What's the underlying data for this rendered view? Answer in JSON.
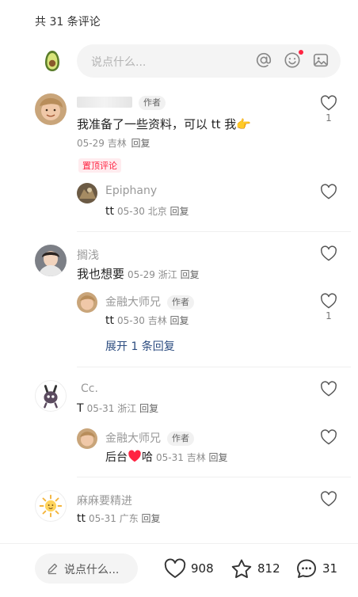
{
  "header": {
    "count_text": "共 31 条评论"
  },
  "composer": {
    "placeholder": "说点什么...",
    "icons": [
      "at-icon",
      "emoji-icon",
      "image-icon"
    ]
  },
  "comments": [
    {
      "nick": "",
      "author_tag": "作者",
      "text": "我准备了一些资料，可以 tt 我👉",
      "date": "05-29",
      "location": "吉林",
      "reply": "回复",
      "pinned": "置顶评论",
      "likes": "1",
      "replies": [
        {
          "nick": "Epiphany",
          "text": "tt",
          "date": "05-30",
          "location": "北京",
          "reply": "回复"
        }
      ]
    },
    {
      "nick": "搁浅",
      "text": "我也想要",
      "date": "05-29",
      "location": "浙江",
      "reply": "回复",
      "replies": [
        {
          "nick": "金融大师兄",
          "author_tag": "作者",
          "text": "tt",
          "date": "05-30",
          "location": "吉林",
          "reply": "回复",
          "likes": "1"
        }
      ],
      "expand": "展开 1 条回复"
    },
    {
      "nick": "Cc.",
      "text": "T",
      "date": "05-31",
      "location": "浙江",
      "reply": "回复",
      "replies": [
        {
          "nick": "金融大师兄",
          "author_tag": "作者",
          "text_before": "后台",
          "text_after": "哈",
          "date": "05-31",
          "location": "吉林",
          "reply": "回复"
        }
      ]
    },
    {
      "nick": "麻麻要精进",
      "text": "tt",
      "date": "05-31",
      "location": "广东",
      "reply": "回复"
    }
  ],
  "bottom_bar": {
    "placeholder": "说点什么...",
    "likes": "908",
    "collects": "812",
    "comments": "31"
  }
}
